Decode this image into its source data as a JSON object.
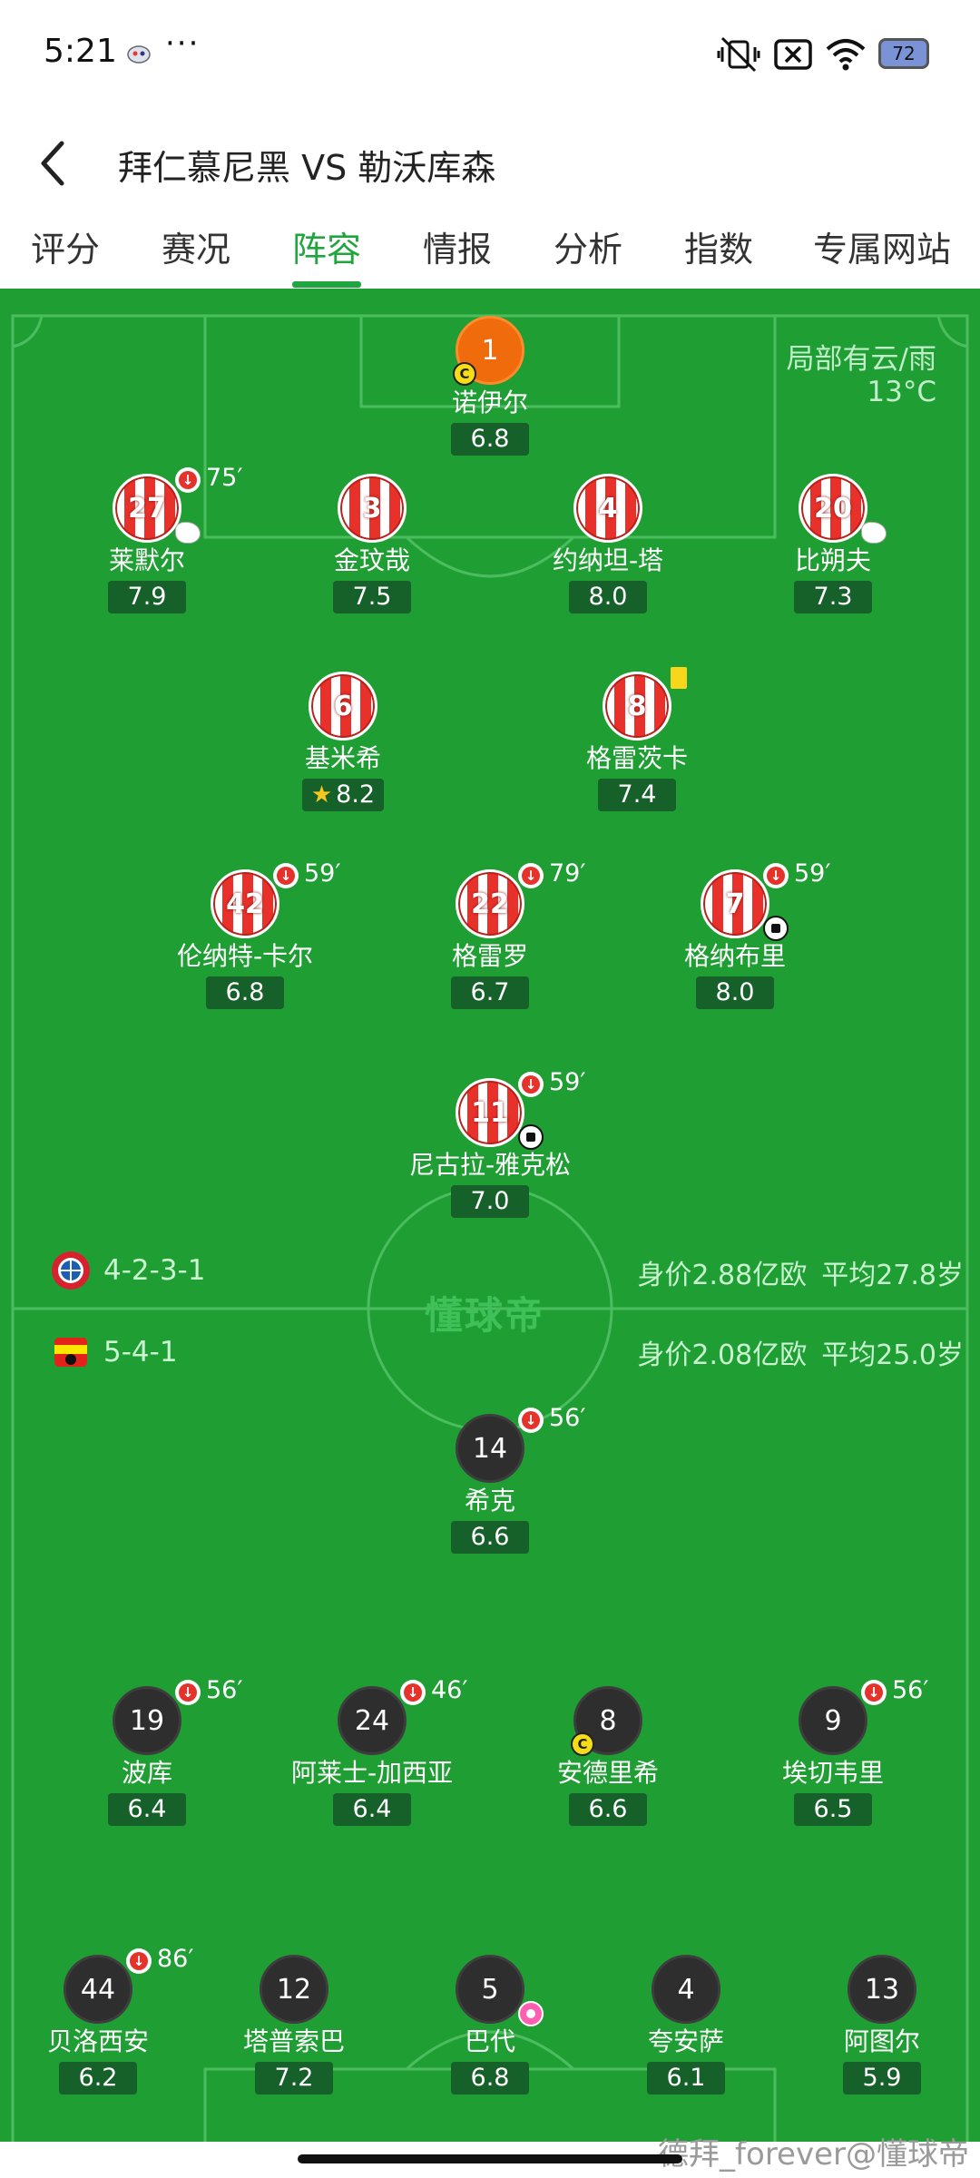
{
  "status_bar": {
    "time": "5:21",
    "more": "···",
    "battery": "72"
  },
  "header": {
    "title": "拜仁慕尼黑 VS 勒沃库森"
  },
  "tabs": [
    {
      "label": "评分",
      "active": false
    },
    {
      "label": "赛况",
      "active": false
    },
    {
      "label": "阵容",
      "active": true
    },
    {
      "label": "情报",
      "active": false
    },
    {
      "label": "分析",
      "active": false
    },
    {
      "label": "指数",
      "active": false
    },
    {
      "label": "专属网站",
      "active": false
    }
  ],
  "weather": {
    "condition": "局部有云/雨",
    "temperature": "13°C"
  },
  "home": {
    "formation": "4-2-3-1",
    "value": "身价2.88亿欧",
    "avg_age": "平均27.8岁",
    "players": [
      {
        "number": "1",
        "name": "诺伊尔",
        "rating": "6.8",
        "captain": true,
        "kit": "orange"
      },
      {
        "number": "27",
        "name": "莱默尔",
        "rating": "7.9",
        "sub": "75′",
        "glove": true,
        "kit": "red"
      },
      {
        "number": "3",
        "name": "金玟哉",
        "rating": "7.5",
        "kit": "red"
      },
      {
        "number": "4",
        "name": "约纳坦-塔",
        "rating": "8.0",
        "kit": "red"
      },
      {
        "number": "20",
        "name": "比朔夫",
        "rating": "7.3",
        "glove": true,
        "kit": "red"
      },
      {
        "number": "6",
        "name": "基米希",
        "rating": "8.2",
        "motm": true,
        "kit": "red"
      },
      {
        "number": "8",
        "name": "格雷茨卡",
        "rating": "7.4",
        "yellow_card": true,
        "kit": "red"
      },
      {
        "number": "42",
        "name": "伦纳特-卡尔",
        "rating": "6.8",
        "sub": "59′",
        "kit": "red"
      },
      {
        "number": "22",
        "name": "格雷罗",
        "rating": "6.7",
        "sub": "79′",
        "kit": "red"
      },
      {
        "number": "7",
        "name": "格纳布里",
        "rating": "8.0",
        "sub": "59′",
        "goal": true,
        "kit": "red"
      },
      {
        "number": "11",
        "name": "尼古拉-雅克松",
        "rating": "7.0",
        "sub": "59′",
        "goal": true,
        "kit": "red"
      }
    ]
  },
  "away": {
    "formation": "5-4-1",
    "value": "身价2.08亿欧",
    "avg_age": "平均25.0岁",
    "players": [
      {
        "number": "14",
        "name": "希克",
        "rating": "6.6",
        "sub": "56′",
        "kit": "dark"
      },
      {
        "number": "19",
        "name": "波库",
        "rating": "6.4",
        "sub": "56′",
        "kit": "dark"
      },
      {
        "number": "24",
        "name": "阿莱士-加西亚",
        "rating": "6.4",
        "sub": "46′",
        "kit": "dark"
      },
      {
        "number": "8",
        "name": "安德里希",
        "rating": "6.6",
        "captain": true,
        "kit": "dark"
      },
      {
        "number": "9",
        "name": "埃切韦里",
        "rating": "6.5",
        "sub": "56′",
        "kit": "dark"
      },
      {
        "number": "44",
        "name": "贝洛西安",
        "rating": "6.2",
        "sub": "86′",
        "kit": "dark"
      },
      {
        "number": "12",
        "name": "塔普索巴",
        "rating": "7.2",
        "kit": "dark"
      },
      {
        "number": "5",
        "name": "巴代",
        "rating": "6.8",
        "own_goal": true,
        "kit": "dark"
      },
      {
        "number": "4",
        "name": "夸安萨",
        "rating": "6.1",
        "kit": "dark"
      },
      {
        "number": "13",
        "name": "阿图尔",
        "rating": "5.9",
        "kit": "dark"
      }
    ]
  },
  "pitch_logo": "懂球帝",
  "credit": "德拜_forever@懂球帝",
  "colors": {
    "accent": "#21a53e",
    "pitch": "#1f9e33",
    "rating_bg": "#16602a",
    "home_kit": "#e8312b",
    "away_kit": "#2e2e2e"
  }
}
